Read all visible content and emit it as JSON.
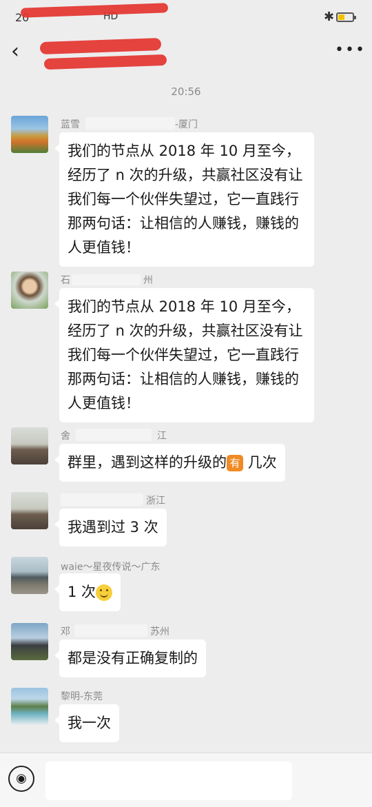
{
  "status_bar": {
    "time": "20",
    "network": "HD",
    "bluetooth_icon": "bluetooth-icon",
    "battery_icon": "battery-icon"
  },
  "title_bar": {
    "title": "",
    "back_icon": "back-chevron-icon",
    "more_icon": "more-dots-icon"
  },
  "timestamp": "20:56",
  "messages": [
    {
      "sender": "蓝雪",
      "sender_suffix": "-厦门",
      "text": "我们的节点从 2018 年 10 月至今，经历了 n 次的升级，共赢社区没有让我们每一个伙伴失望过，它一直践行那两句话：让相信的人赚钱，赚钱的人更值钱！"
    },
    {
      "sender": "石",
      "sender_suffix": "州",
      "text": "我们的节点从 2018 年 10 月至今，经历了 n 次的升级，共赢社区没有让我们每一个伙伴失望过，它一直践行那两句话：让相信的人赚钱，赚钱的人更值钱！"
    },
    {
      "sender": "舍",
      "sender_suffix": "江",
      "text": "群里，遇到这样的升级的",
      "emoji": "有",
      "text_after": " 几次"
    },
    {
      "sender": "",
      "sender_suffix": "浙江",
      "text": "我遇到过 3 次"
    },
    {
      "sender": "waie～星夜传说～广东",
      "sender_suffix": "",
      "text": "1 次",
      "emoji_icon": "smiley-icon"
    },
    {
      "sender": "邓",
      "sender_suffix": "苏州",
      "text": "都是没有正确复制的"
    },
    {
      "sender": "黎明-东莞",
      "sender_suffix": "",
      "text": "我一次"
    }
  ],
  "input_bar": {
    "voice_icon": "voice-icon",
    "placeholder": ""
  },
  "colors": {
    "background": "#ededed",
    "bubble": "#ffffff",
    "redaction": "#e3342f"
  }
}
